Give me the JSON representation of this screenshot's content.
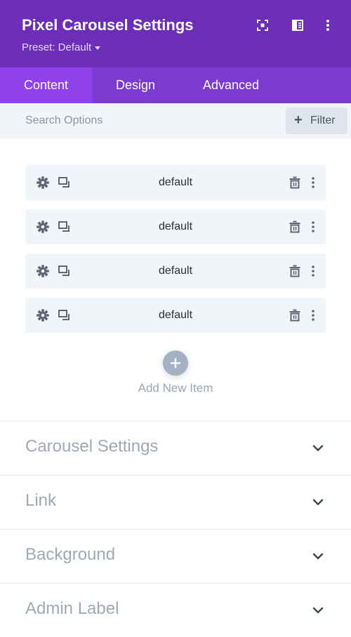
{
  "header": {
    "title": "Pixel Carousel Settings",
    "preset_label": "Preset: Default",
    "icons": [
      "focus-icon",
      "sidebar-layout-icon",
      "kebab-menu-icon"
    ]
  },
  "tabs": [
    {
      "label": "Content",
      "active": true
    },
    {
      "label": "Design",
      "active": false
    },
    {
      "label": "Advanced",
      "active": false
    }
  ],
  "search": {
    "placeholder": "Search Options",
    "value": "",
    "filter_label": "Filter"
  },
  "items": [
    {
      "label": "default",
      "icons": [
        "gear-icon",
        "duplicate-icon",
        "trash-icon",
        "more-icon"
      ]
    },
    {
      "label": "default",
      "icons": [
        "gear-icon",
        "duplicate-icon",
        "trash-icon",
        "more-icon"
      ]
    },
    {
      "label": "default",
      "icons": [
        "gear-icon",
        "duplicate-icon",
        "trash-icon",
        "more-icon"
      ]
    },
    {
      "label": "default",
      "icons": [
        "gear-icon",
        "duplicate-icon",
        "trash-icon",
        "more-icon"
      ]
    }
  ],
  "add_item": {
    "label": "Add New Item",
    "icon": "plus-icon"
  },
  "sections": [
    {
      "title": "Carousel Settings",
      "icon": "chevron-down-icon"
    },
    {
      "title": "Link",
      "icon": "chevron-down-icon"
    },
    {
      "title": "Background",
      "icon": "chevron-down-icon"
    },
    {
      "title": "Admin Label",
      "icon": "chevron-down-icon"
    }
  ],
  "colors": {
    "header_bg": "#6c2eb9",
    "tabs_bg": "#7b3ad0",
    "active_tab_bg": "#8f42ec",
    "panel_bg": "#f1f5f9",
    "muted_text": "#9ea9b8"
  }
}
